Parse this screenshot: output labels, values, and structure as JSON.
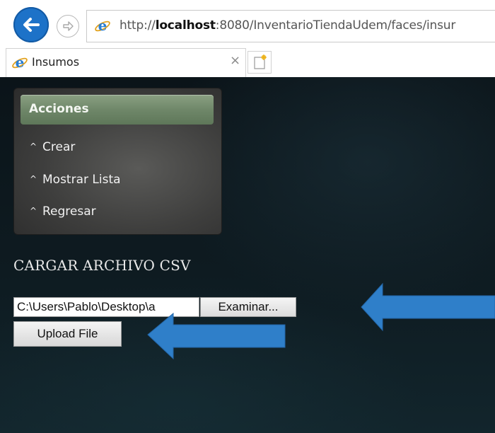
{
  "browser": {
    "url_prefix": "http://",
    "url_host": "localhost",
    "url_rest": ":8080/InventarioTiendaUdem/faces/insur",
    "tab_title": "Insumos",
    "tab_close": "×"
  },
  "sidebar": {
    "header": "Acciones",
    "items": [
      {
        "label": "Crear"
      },
      {
        "label": "Mostrar Lista"
      },
      {
        "label": "Regresar"
      }
    ]
  },
  "main": {
    "heading": "CARGAR ARCHIVO CSV",
    "file_path": "C:\\Users\\Pablo\\Desktop\\a",
    "browse_label": "Examinar...",
    "upload_label": "Upload File"
  },
  "annotations": {
    "arrow_color": "#2f7fc9"
  },
  "colors": {
    "page_background": "#0e1b21",
    "panel_header": "#6f8769",
    "ie_blue": "#1d72c8"
  },
  "icons": {
    "back": "back-arrow-icon",
    "forward": "forward-arrow-icon",
    "browser": "internet-explorer-icon",
    "new_tab": "new-tab-icon",
    "menu_caret": "caret-up-icon"
  }
}
